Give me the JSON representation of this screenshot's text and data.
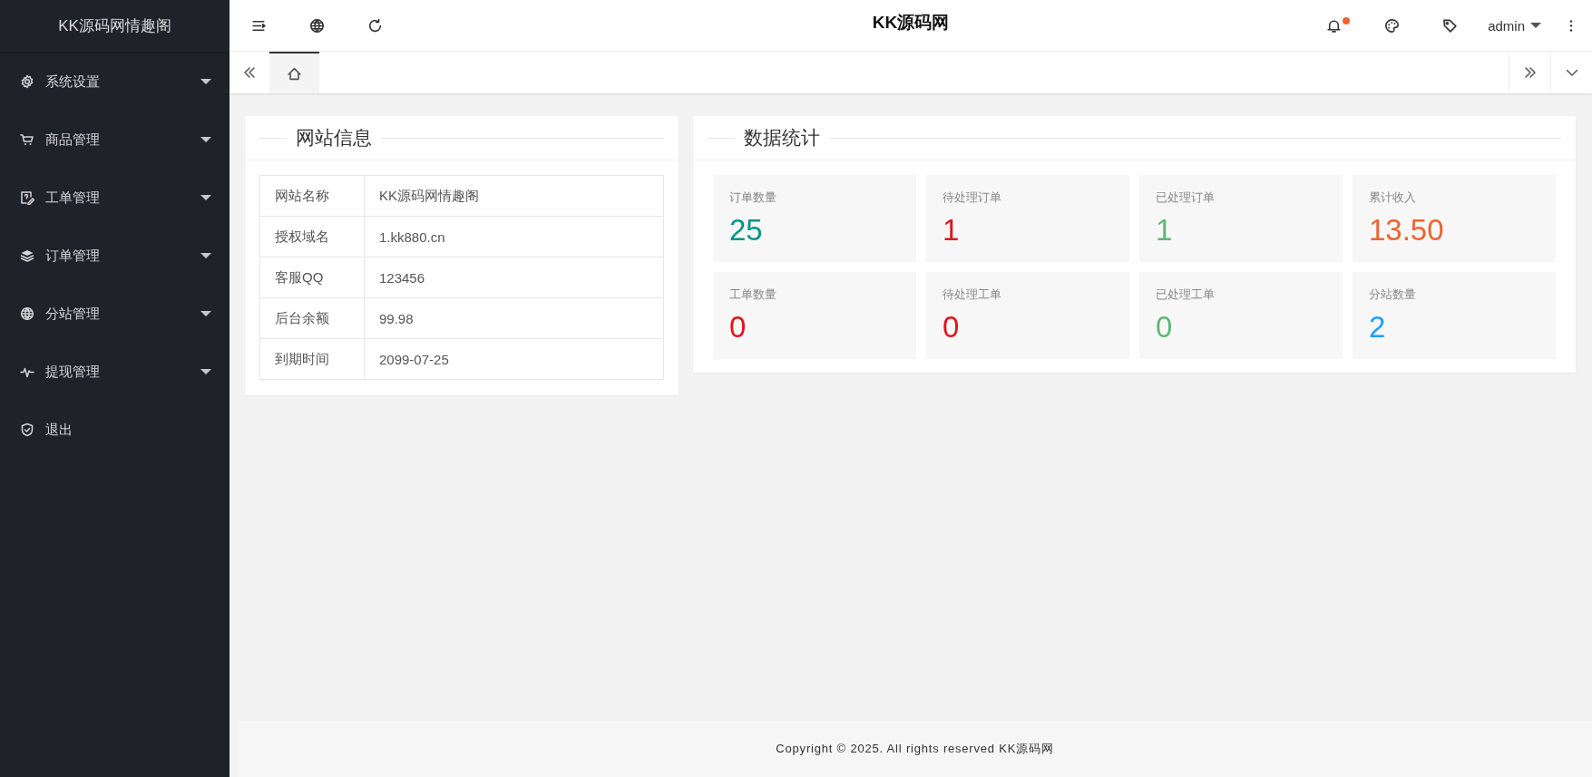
{
  "sidebar": {
    "brand": "KK源码网情趣阁",
    "items": [
      {
        "label": "系统设置",
        "kind": "menu"
      },
      {
        "label": "商品管理",
        "kind": "menu"
      },
      {
        "label": "工单管理",
        "kind": "menu"
      },
      {
        "label": "订单管理",
        "kind": "menu"
      },
      {
        "label": "分站管理",
        "kind": "menu"
      },
      {
        "label": "提现管理",
        "kind": "menu"
      },
      {
        "label": "退出",
        "kind": "link"
      }
    ]
  },
  "header": {
    "logo": "KK源码网",
    "user": "admin",
    "notification_dot": true
  },
  "tabs": [
    {
      "selected": true
    }
  ],
  "site_info": {
    "title": "网站信息",
    "rows": [
      {
        "label": "网站名称",
        "value": "KK源码网情趣阁"
      },
      {
        "label": "授权域名",
        "value": "1.kk880.cn"
      },
      {
        "label": "客服QQ",
        "value": "123456"
      },
      {
        "label": "后台余额",
        "value": "99.98"
      },
      {
        "label": "到期时间",
        "value": "2099-07-25"
      }
    ]
  },
  "stats": {
    "title": "数据统计",
    "items": [
      {
        "label": "订单数量",
        "value": "25",
        "color": "#009688"
      },
      {
        "label": "待处理订单",
        "value": "1",
        "color": "#e3141a"
      },
      {
        "label": "已处理订单",
        "value": "1",
        "color": "#5fb878"
      },
      {
        "label": "累计收入",
        "value": "13.50",
        "color": "#f0622f"
      },
      {
        "label": "工单数量",
        "value": "0",
        "color": "#e3141a"
      },
      {
        "label": "待处理工单",
        "value": "0",
        "color": "#e3141a"
      },
      {
        "label": "已处理工单",
        "value": "0",
        "color": "#5fb878"
      },
      {
        "label": "分站数量",
        "value": "2",
        "color": "#1e9fff"
      }
    ]
  },
  "footer": "Copyright © 2025. All rights reserved KK源码网"
}
